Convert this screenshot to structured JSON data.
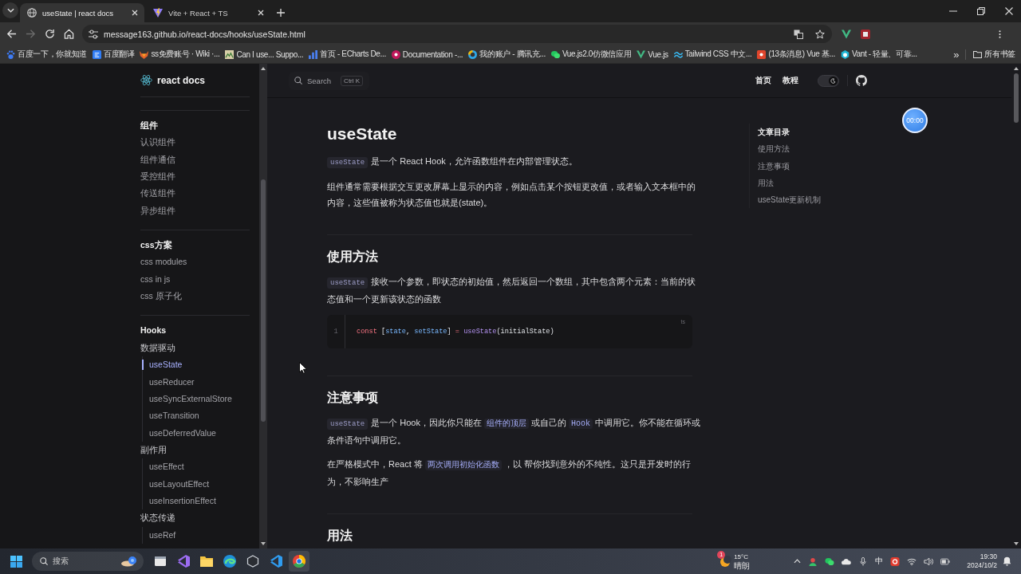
{
  "browser": {
    "tabs": [
      {
        "title": "useState | react docs",
        "selected": true
      },
      {
        "title": "Vite + React + TS",
        "selected": false
      }
    ],
    "forward_disabled": true,
    "address": "message163.github.io/react-docs/hooks/useState.html",
    "bookmarks": [
      "百度一下，你就知道",
      "百度翻译",
      "ss免费账号 · Wiki ·...",
      "Can I use... Suppo...",
      "首页 - ECharts De...",
      "Documentation -...",
      "我的账户 - 腾讯充...",
      "Vue.js2.0仿微信应用",
      "Vue.js",
      "Tailwind CSS 中文...",
      "(13条消息) Vue 基...",
      "Vant - 轻量、可靠..."
    ],
    "overflow": "»",
    "all_bookmarks": "所有书签"
  },
  "site": {
    "logo": "react docs",
    "search": {
      "placeholder": "Search",
      "shortcut": "Ctrl K"
    },
    "nav": [
      "首页",
      "教程"
    ],
    "dark_mode": true
  },
  "sidebar": {
    "groups": [
      {
        "title": "组件",
        "items": [
          {
            "label": "认识组件",
            "selected": false
          },
          {
            "label": "组件通信",
            "selected": false
          },
          {
            "label": "受控组件",
            "selected": false
          },
          {
            "label": "传送组件",
            "selected": false
          },
          {
            "label": "异步组件",
            "selected": false
          }
        ]
      },
      {
        "title": "css方案",
        "items": [
          {
            "label": "css modules",
            "selected": false
          },
          {
            "label": "css in js",
            "selected": false
          },
          {
            "label": "css 原子化",
            "selected": false
          }
        ]
      },
      {
        "title": "Hooks",
        "items": [
          {
            "label": "数据驱动",
            "children": [
              {
                "label": "useState",
                "selected": true
              },
              {
                "label": "useReducer",
                "selected": false
              },
              {
                "label": "useSyncExternalStore",
                "selected": false
              },
              {
                "label": "useTransition",
                "selected": false
              },
              {
                "label": "useDeferredValue",
                "selected": false
              }
            ]
          },
          {
            "label": "副作用",
            "children": [
              {
                "label": "useEffect",
                "selected": false
              },
              {
                "label": "useLayoutEffect",
                "selected": false
              },
              {
                "label": "useInsertionEffect",
                "selected": false
              }
            ]
          },
          {
            "label": "状态传递",
            "children": [
              {
                "label": "useRef",
                "selected": false
              }
            ]
          }
        ]
      }
    ]
  },
  "article": {
    "blocks": [
      {
        "kind": "h1",
        "text": "useState"
      },
      {
        "kind": "p",
        "segments": [
          {
            "kind": "code",
            "text": "useState"
          },
          {
            "kind": "text",
            "text": "是一个 React Hook，允许函数组件在内部管理状态。"
          }
        ]
      },
      {
        "kind": "p",
        "segments": [
          {
            "kind": "text",
            "text": "组件通常需要根据交互更改屏幕上显示的内容，例如点击某个按钮更改值，或者输入文本框中的内容，这些值被称为状态值也就是(state)。"
          }
        ]
      },
      {
        "kind": "hr"
      },
      {
        "kind": "h2",
        "text": "使用方法"
      },
      {
        "kind": "p",
        "segments": [
          {
            "kind": "code",
            "text": "useState"
          },
          {
            "kind": "text",
            "text": "接收一个参数，即状态的初始值，然后返回一个数组，其中包含两个元素：当前的状态值和一个更新该状态的函数"
          }
        ]
      },
      {
        "kind": "code",
        "lang": "ts",
        "lines": [
          {
            "number": "1",
            "tokens": [
              {
                "kind": "keyword",
                "text": "const"
              },
              {
                "kind": "plain",
                "text": " ["
              },
              {
                "kind": "variable",
                "text": "state"
              },
              {
                "kind": "plain",
                "text": ", "
              },
              {
                "kind": "variable",
                "text": "setState"
              },
              {
                "kind": "plain",
                "text": "] "
              },
              {
                "kind": "operator",
                "text": "= "
              },
              {
                "kind": "function",
                "text": "useState"
              },
              {
                "kind": "plain",
                "text": "(initialState)"
              }
            ]
          }
        ]
      },
      {
        "kind": "hr"
      },
      {
        "kind": "h2",
        "text": "注意事项"
      },
      {
        "kind": "p",
        "segments": [
          {
            "kind": "code",
            "text": "useState"
          },
          {
            "kind": "text",
            "text": "是一个 Hook，因此你只能在"
          },
          {
            "kind": "link",
            "text": "组件的顶层"
          },
          {
            "kind": "text",
            "text": "或自己的"
          },
          {
            "kind": "link",
            "text": "Hook"
          },
          {
            "kind": "text",
            "text": "中调用它。你不能在循环或条件语句中调用它。"
          }
        ]
      },
      {
        "kind": "p",
        "segments": [
          {
            "kind": "text",
            "text": "在严格模式中，React 将"
          },
          {
            "kind": "link",
            "text": "两次调用初始化函数"
          },
          {
            "kind": "text",
            "text": "，以 帮你找到意外的不纯性。这只是开发时的行为，不影响生产"
          }
        ]
      },
      {
        "kind": "hr"
      },
      {
        "kind": "h2",
        "text": "用法"
      }
    ]
  },
  "toc": {
    "title": "文章目录",
    "items": [
      {
        "label": "使用方法",
        "selected": false
      },
      {
        "label": "注意事项",
        "selected": false
      },
      {
        "label": "用法",
        "selected": false
      },
      {
        "label": "useState更新机制",
        "selected": false
      }
    ]
  },
  "recorder": {
    "time": "00:00"
  },
  "taskbar": {
    "search_placeholder": "搜索",
    "weather": {
      "badge": "1",
      "temperature": "15°C",
      "condition": "晴朗"
    },
    "ime": "中",
    "time": "19:30",
    "date": "2024/10/2"
  }
}
